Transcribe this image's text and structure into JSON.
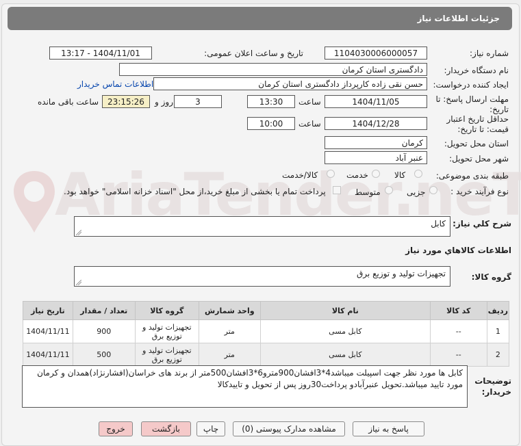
{
  "title": "جزئیات اطلاعات نیاز",
  "watermark": "AriaTender.neT",
  "labels": {
    "need_number": "شماره نیاز:",
    "announce_datetime": "تاریخ و ساعت اعلان عمومی:",
    "buyer_org": "نام دستگاه خریدار:",
    "requester": "ایجاد کننده درخواست:",
    "reply_deadline": "مهلت ارسال پاسخ: تا تاریخ:",
    "time": "ساعت",
    "day_and": "روز و",
    "time_remaining": "ساعت باقی مانده",
    "min_price_validity": "حداقل تاریخ اعتبار قیمت: تا تاریخ:",
    "delivery_province": "استان محل تحویل:",
    "delivery_city": "شهر محل تحویل:",
    "subject_category": "طبقه بندی موضوعی:",
    "purchase_process": "نوع فرآیند خرید :",
    "general_description": "شرح کلي نياز:",
    "goods_info": "اطلاعات کالاهاي مورد نياز",
    "goods_group": "گروه کالا:",
    "buyer_notes": "توضیحات خریدار:"
  },
  "values": {
    "need_number": "1104030006000057",
    "announce_datetime": "1404/11/01 - 13:17",
    "buyer_org": "دادگستری استان کرمان",
    "requester": "حسن نقی زاده کارپرداز دادگستری استان کرمان",
    "contact_link": "اطلاعات تماس خریدار",
    "reply_date": "1404/11/05",
    "reply_time": "13:30",
    "days_remaining": "3",
    "time_remaining": "23:15:26",
    "validity_date": "1404/12/28",
    "validity_time": "10:00",
    "province": "کرمان",
    "city": "عنبر آباد",
    "general_description": "کابل",
    "goods_group": "تجهیزات تولید و توزیع برق",
    "buyer_notes": "کابل ها مورد نظر جهت اسپیلت میباشد4*3افشان900مترو6*3افشان500متر از برند های خراسان(افشارنژاد)همدان و کرمان مورد تایید میباشد.تحویل عنبرآبادو پرداخت30روز پس از تحویل و تاییدکالا"
  },
  "subject_options": [
    "کالا",
    "خدمت",
    "کالا/خدمت"
  ],
  "process_options": [
    "جزیی",
    "متوسط"
  ],
  "payment_note": "پرداخت تمام یا بخشی از مبلغ خرید،از محل \"اسناد خزانه اسلامی\" خواهد بود.",
  "table": {
    "headers": [
      "ردیف",
      "کد کالا",
      "نام کالا",
      "واحد شمارش",
      "گروه کالا",
      "تعداد / مقدار",
      "تاریخ نیاز"
    ],
    "rows": [
      {
        "row": "1",
        "code": "--",
        "name": "کابل مسی",
        "unit": "متر",
        "group": "تجهیزات تولید و توزیع برق",
        "qty": "900",
        "date": "1404/11/11"
      },
      {
        "row": "2",
        "code": "--",
        "name": "کابل مسی",
        "unit": "متر",
        "group": "تجهیزات تولید و توزیع برق",
        "qty": "500",
        "date": "1404/11/11"
      }
    ]
  },
  "buttons": {
    "reply": "پاسخ به نیاز",
    "view_docs": "مشاهده مدارک پیوستی (0)",
    "print": "چاپ",
    "back": "بازگشت",
    "exit": "خروج"
  }
}
